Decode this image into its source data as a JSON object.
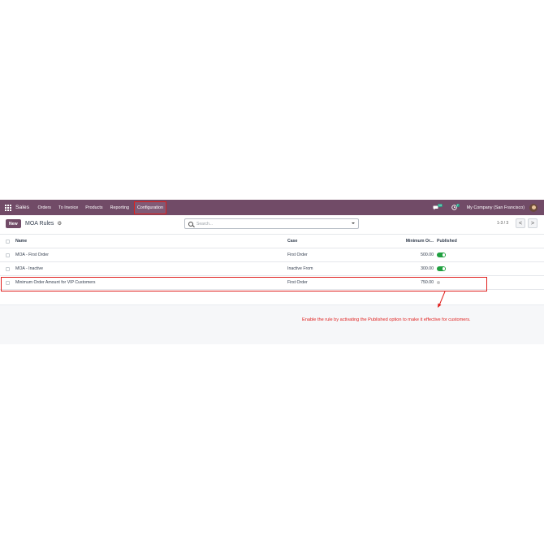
{
  "navbar": {
    "brand": "Sales",
    "menu": [
      "Orders",
      "To Invoice",
      "Products",
      "Reporting",
      "Configuration"
    ],
    "messages_badge": "14",
    "activities_badge": "7",
    "company": "My Company (San Francisco)"
  },
  "control": {
    "new_label": "New",
    "title": "MOA Rules",
    "search_placeholder": "Search...",
    "pager": "1-3 / 3",
    "prev": "<",
    "next": ">"
  },
  "table": {
    "headers": {
      "name": "Name",
      "case": "Case",
      "min": "Minimum Or...",
      "published": "Published"
    },
    "rows": [
      {
        "name": "MOA - First Order",
        "case": "First Order",
        "min": "500.00",
        "published": true
      },
      {
        "name": "MOA - Inactive",
        "case": "Inactive From",
        "min": "300.00",
        "published": true
      },
      {
        "name": "Minimum Order Amount for VIP Customers",
        "case": "First Order",
        "min": "750.00",
        "published": false
      }
    ]
  },
  "annotation": "Enable the rule by activating the Published option to make it effective for customers.",
  "colors": {
    "navbar": "#714b67",
    "toggle_on": "#1fa03f",
    "annotation": "#e0201e"
  }
}
